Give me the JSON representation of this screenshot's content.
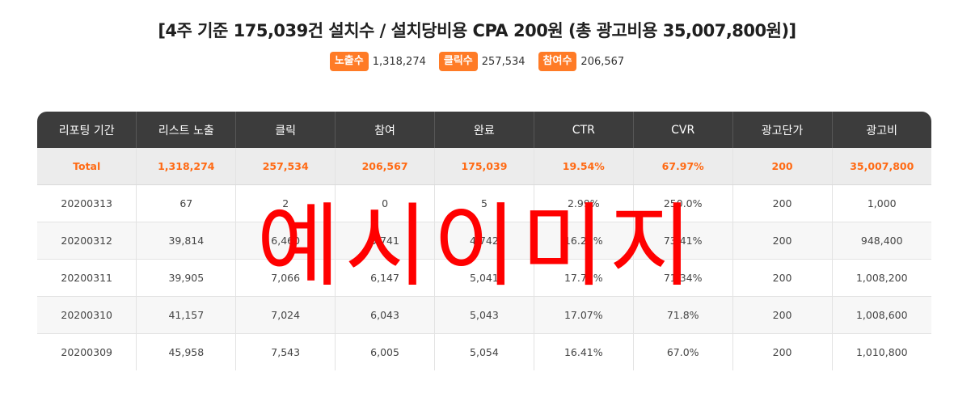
{
  "headline": "[4주 기준 175,039건 설치수 / 설치당비용 CPA 200원 (총 광고비용 35,007,800원)]",
  "stats": [
    {
      "label": "노출수",
      "value": "1,318,274"
    },
    {
      "label": "클릭수",
      "value": "257,534"
    },
    {
      "label": "참여수",
      "value": "206,567"
    }
  ],
  "accent_color": "#ff7b26",
  "table": {
    "headers": [
      "리포팅 기간",
      "리스트 노출",
      "클릭",
      "참여",
      "완료",
      "CTR",
      "CVR",
      "광고단가",
      "광고비"
    ],
    "total": [
      "Total",
      "1,318,274",
      "257,534",
      "206,567",
      "175,039",
      "19.54%",
      "67.97%",
      "200",
      "35,007,800"
    ],
    "rows": [
      [
        "20200313",
        "67",
        "2",
        "0",
        "5",
        "2.99%",
        "250.0%",
        "200",
        "1,000"
      ],
      [
        "20200312",
        "39,814",
        "6,460",
        "5,741",
        "4,742",
        "16.23%",
        "73.41%",
        "200",
        "948,400"
      ],
      [
        "20200311",
        "39,905",
        "7,066",
        "6,147",
        "5,041",
        "17.71%",
        "71.34%",
        "200",
        "1,008,200"
      ],
      [
        "20200310",
        "41,157",
        "7,024",
        "6,043",
        "5,043",
        "17.07%",
        "71.8%",
        "200",
        "1,008,600"
      ],
      [
        "20200309",
        "45,958",
        "7,543",
        "6,005",
        "5,054",
        "16.41%",
        "67.0%",
        "200",
        "1,010,800"
      ]
    ]
  },
  "watermark": "예시이미지"
}
